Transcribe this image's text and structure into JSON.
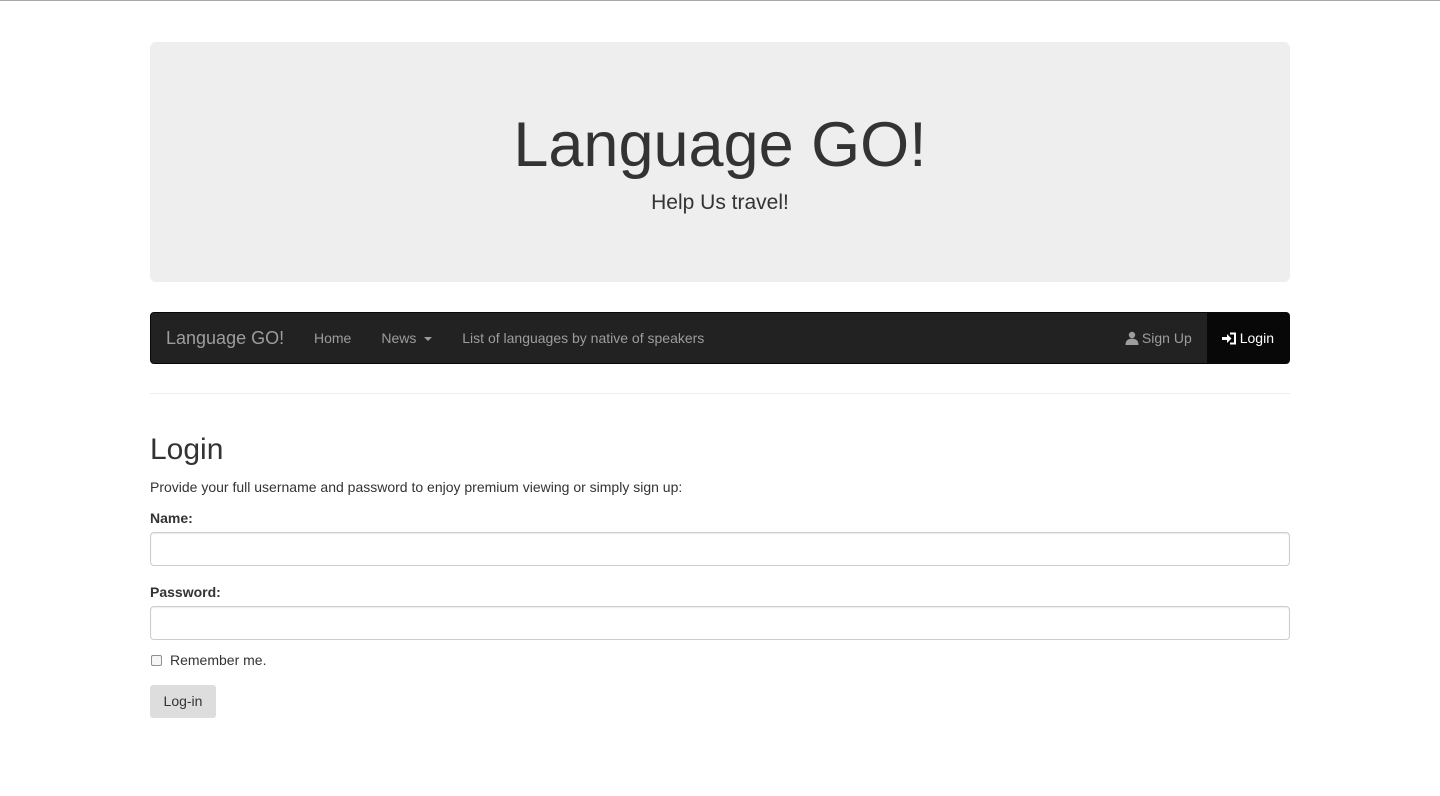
{
  "jumbotron": {
    "title": "Language GO!",
    "subtitle": "Help Us travel!"
  },
  "navbar": {
    "brand": "Language GO!",
    "left_items": [
      {
        "label": "Home"
      },
      {
        "label": "News"
      },
      {
        "label": "List of languages by native of speakers"
      }
    ],
    "right_items": [
      {
        "label": "Sign Up",
        "icon": "user-icon"
      },
      {
        "label": "Login",
        "icon": "log-in-icon",
        "active": true
      }
    ]
  },
  "login": {
    "title": "Login",
    "description": "Provide your full username and password to enjoy premium viewing or simply sign up:",
    "name_label": "Name:",
    "name_value": "",
    "password_label": "Password:",
    "password_value": "",
    "remember_label": "Remember me.",
    "remember_checked": false,
    "submit_label": "Log-in"
  },
  "colors": {
    "navbar_bg": "#222222",
    "navbar_active_bg": "#080808",
    "jumbotron_bg": "#eeeeee",
    "button_bg": "#dddddd"
  }
}
